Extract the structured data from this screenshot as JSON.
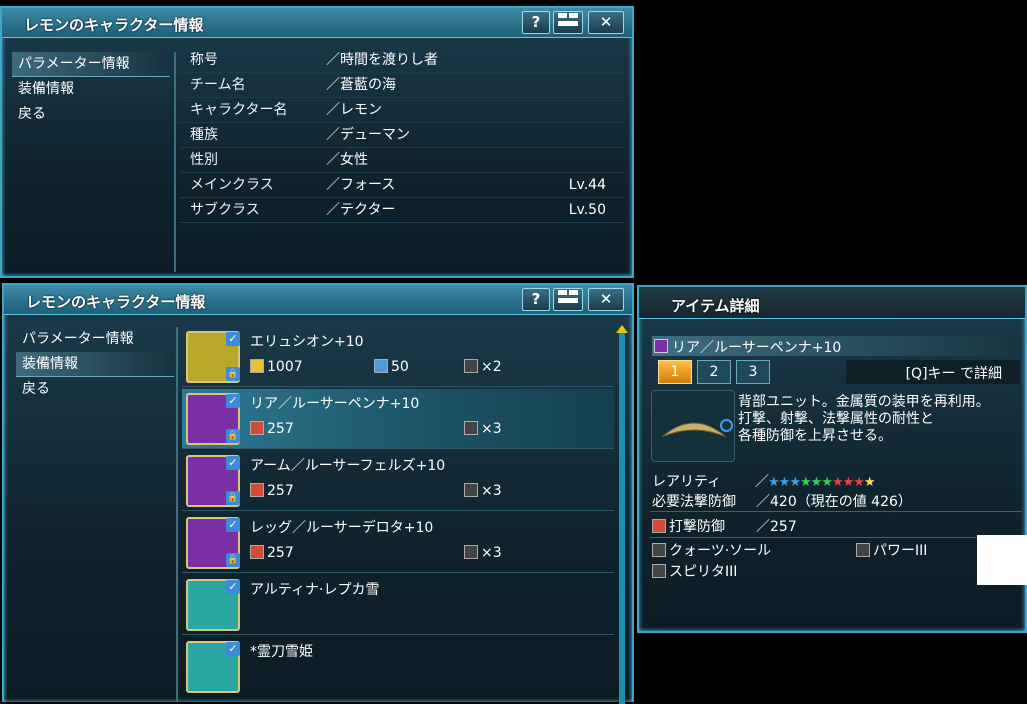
{
  "top_window": {
    "title": "レモンのキャラクター情報",
    "buttons": {
      "help": "?",
      "close": "✕"
    },
    "menu": [
      {
        "label": "パラメーター情報",
        "selected": true
      },
      {
        "label": "装備情報",
        "selected": false
      },
      {
        "label": "戻る",
        "selected": false
      }
    ],
    "params": [
      {
        "label": "称号",
        "value": "／時間を渡りし者",
        "level": ""
      },
      {
        "label": "チーム名",
        "value": "／蒼藍の海",
        "level": ""
      },
      {
        "label": "キャラクター名",
        "value": "／レモン",
        "level": ""
      },
      {
        "label": "種族",
        "value": "／デューマン",
        "level": ""
      },
      {
        "label": "性別",
        "value": "／女性",
        "level": ""
      },
      {
        "label": "メインクラス",
        "value": "／フォース",
        "level": "Lv.44"
      },
      {
        "label": "サブクラス",
        "value": "／テクター",
        "level": "Lv.50"
      }
    ]
  },
  "bottom_window": {
    "title": "レモンのキャラクター情報",
    "buttons": {
      "help": "?",
      "close": "✕"
    },
    "menu": [
      {
        "label": "パラメーター情報",
        "selected": false
      },
      {
        "label": "装備情報",
        "selected": true
      },
      {
        "label": "戻る",
        "selected": false
      }
    ],
    "equipment": [
      {
        "name": "エリュシオン+10",
        "stat1": "1007",
        "stat2": "50",
        "slots": "×2",
        "thumb_color": "#b9a62a",
        "selected": false
      },
      {
        "name": "リア／ルーサーペンナ+10",
        "stat1": "257",
        "stat2": "",
        "slots": "×3",
        "thumb_color": "#7b2fa4",
        "selected": true
      },
      {
        "name": "アーム／ルーサーフェルズ+10",
        "stat1": "257",
        "stat2": "",
        "slots": "×3",
        "thumb_color": "#7b2fa4",
        "selected": false
      },
      {
        "name": "レッグ／ルーサーデロタ+10",
        "stat1": "257",
        "stat2": "",
        "slots": "×3",
        "thumb_color": "#7b2fa4",
        "selected": false
      },
      {
        "name": "アルティナ·レプカ雪",
        "stat1": "",
        "stat2": "",
        "slots": "",
        "thumb_color": "#2aa7a0",
        "selected": false
      },
      {
        "name": "*霊刀雪姫",
        "stat1": "",
        "stat2": "",
        "slots": "",
        "thumb_color": "#2aa7a0",
        "selected": false
      }
    ]
  },
  "item_window": {
    "title": "アイテム詳細",
    "item_name": "リア／ルーサーペンナ+10",
    "tabs": [
      "1",
      "2",
      "3"
    ],
    "detail_hint": "[Q]キー で詳細",
    "description": [
      "背部ユニット。金属質の装甲を再利用。",
      "打撃、射撃、法撃属性の耐性と",
      "各種防御を上昇させる。"
    ],
    "rarity_label": "レアリティ",
    "rarity_sep": "／",
    "rarity_stars": 10,
    "star_colors": [
      "#3ba0e8",
      "#3ba0e8",
      "#3ba0e8",
      "#36d05a",
      "#36d05a",
      "#36d05a",
      "#ef4040",
      "#ef4040",
      "#ef4040",
      "#f6e04a"
    ],
    "req_label": "必要法撃防御",
    "req_value": "／420（現在の値 426）",
    "def_label": "打撃防御",
    "def_value": "／257",
    "abilities": [
      "クォーツ·ソール",
      "パワーIII",
      "スピリタIII"
    ]
  }
}
